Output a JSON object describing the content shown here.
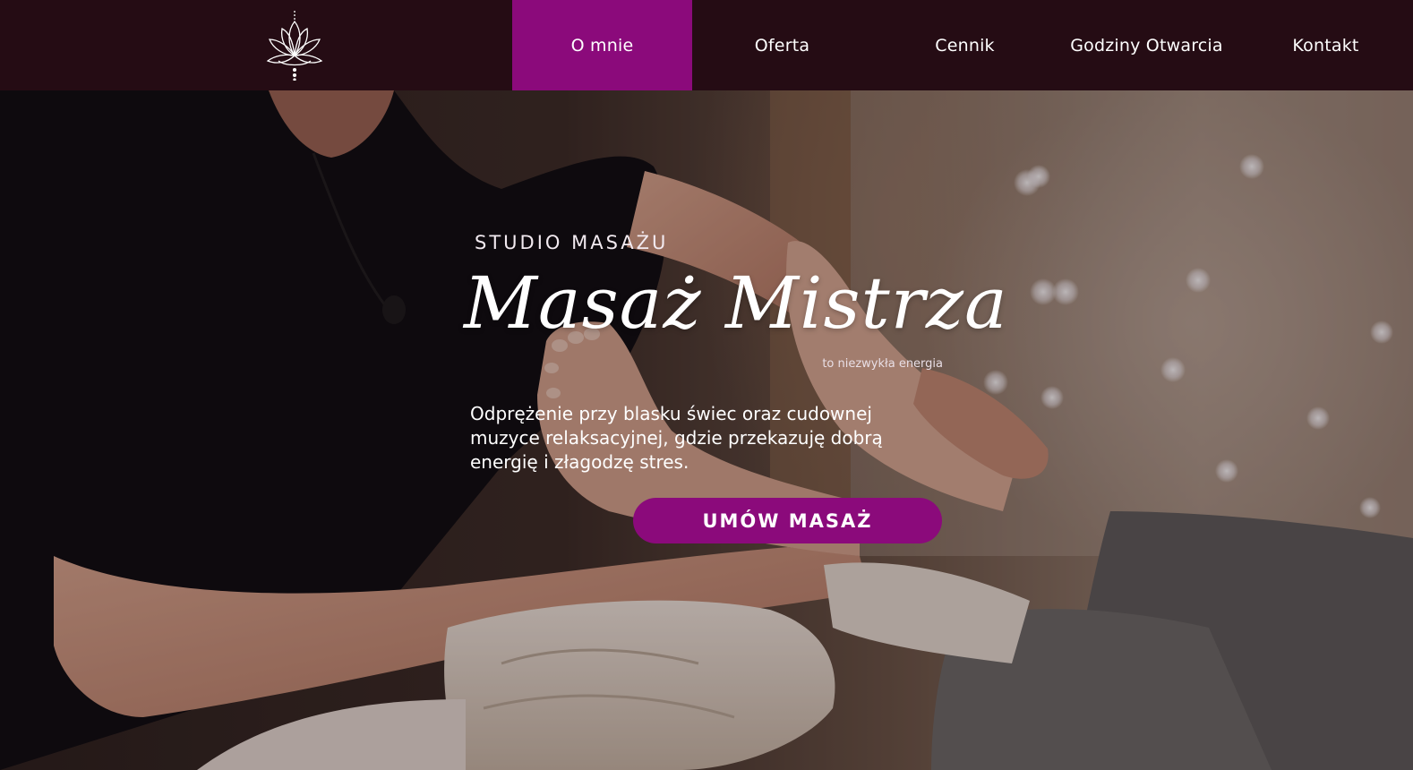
{
  "nav": {
    "logo_icon": "lotus-icon",
    "items": [
      {
        "label": "O mnie",
        "active": true
      },
      {
        "label": "Oferta",
        "active": false
      },
      {
        "label": "Cennik",
        "active": false
      },
      {
        "label": "Godziny Otwarcia",
        "active": false
      },
      {
        "label": "Kontakt",
        "active": false
      }
    ]
  },
  "hero": {
    "subtitle": "STUDIO MASAŻU",
    "title": "Masaż Mistrza",
    "tagline": "to niezwykła energia",
    "description": "Odprężenie przy blasku świec oraz cudownej muzyce relaksacyjnej, gdzie przekazuję dobrą energię i złagodzę stres.",
    "cta_label": "UMÓW MASAŻ"
  },
  "colors": {
    "nav_background": "#250c14",
    "accent": "#8b0a7b",
    "text": "#ffffff"
  }
}
